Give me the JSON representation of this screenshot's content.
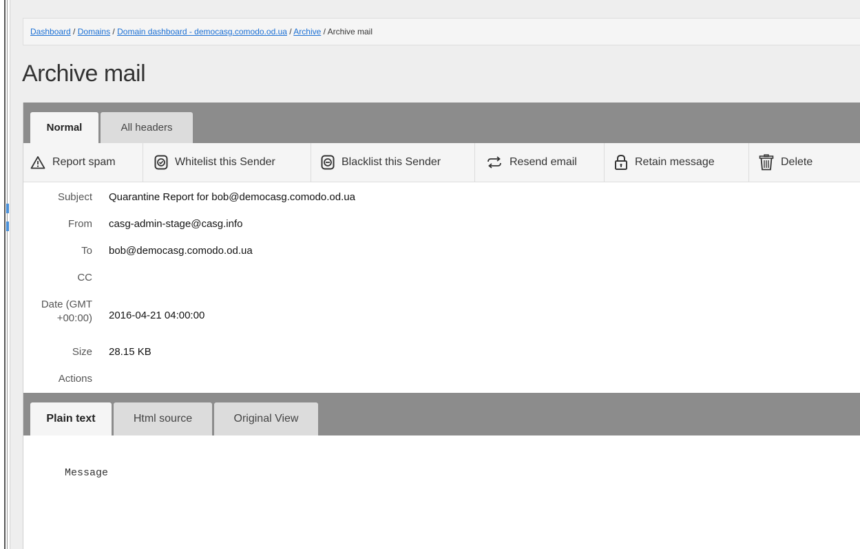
{
  "breadcrumb": {
    "links": [
      "Dashboard",
      "Domains",
      "Domain dashboard - democasg.comodo.od.ua",
      "Archive"
    ],
    "separator": " / ",
    "current": "Archive mail"
  },
  "page_title": "Archive mail",
  "header_tabs": [
    {
      "label": "Normal",
      "active": true
    },
    {
      "label": "All headers",
      "active": false
    }
  ],
  "toolbar": [
    {
      "label": "Report spam",
      "icon": "warning-triangle-icon"
    },
    {
      "label": "Whitelist this Sender",
      "icon": "shield-check-icon"
    },
    {
      "label": "Blacklist this Sender",
      "icon": "shield-minus-icon"
    },
    {
      "label": "Resend email",
      "icon": "resend-arrows-icon"
    },
    {
      "label": "Retain message",
      "icon": "lock-icon"
    },
    {
      "label": "Delete",
      "icon": "trash-icon"
    }
  ],
  "fields": {
    "subject": {
      "label": "Subject",
      "value": "Quarantine Report for bob@democasg.comodo.od.ua"
    },
    "from": {
      "label": "From",
      "value": "casg-admin-stage@casg.info"
    },
    "to": {
      "label": "To",
      "value": "bob@democasg.comodo.od.ua"
    },
    "cc": {
      "label": "CC",
      "value": ""
    },
    "date": {
      "label_line1": "Date (GMT",
      "label_line2": "+00:00)",
      "value": "2016-04-21 04:00:00"
    },
    "size": {
      "label": "Size",
      "value": "28.15 KB"
    },
    "actions": {
      "label": "Actions"
    }
  },
  "body_tabs": [
    {
      "label": "Plain text",
      "active": true
    },
    {
      "label": "Html source",
      "active": false
    },
    {
      "label": "Original View",
      "active": false
    }
  ],
  "message": "Message",
  "colors": {
    "link": "#1a6fd4",
    "tabbar": "#8c8c8c",
    "page_bg": "#eeeeee"
  }
}
